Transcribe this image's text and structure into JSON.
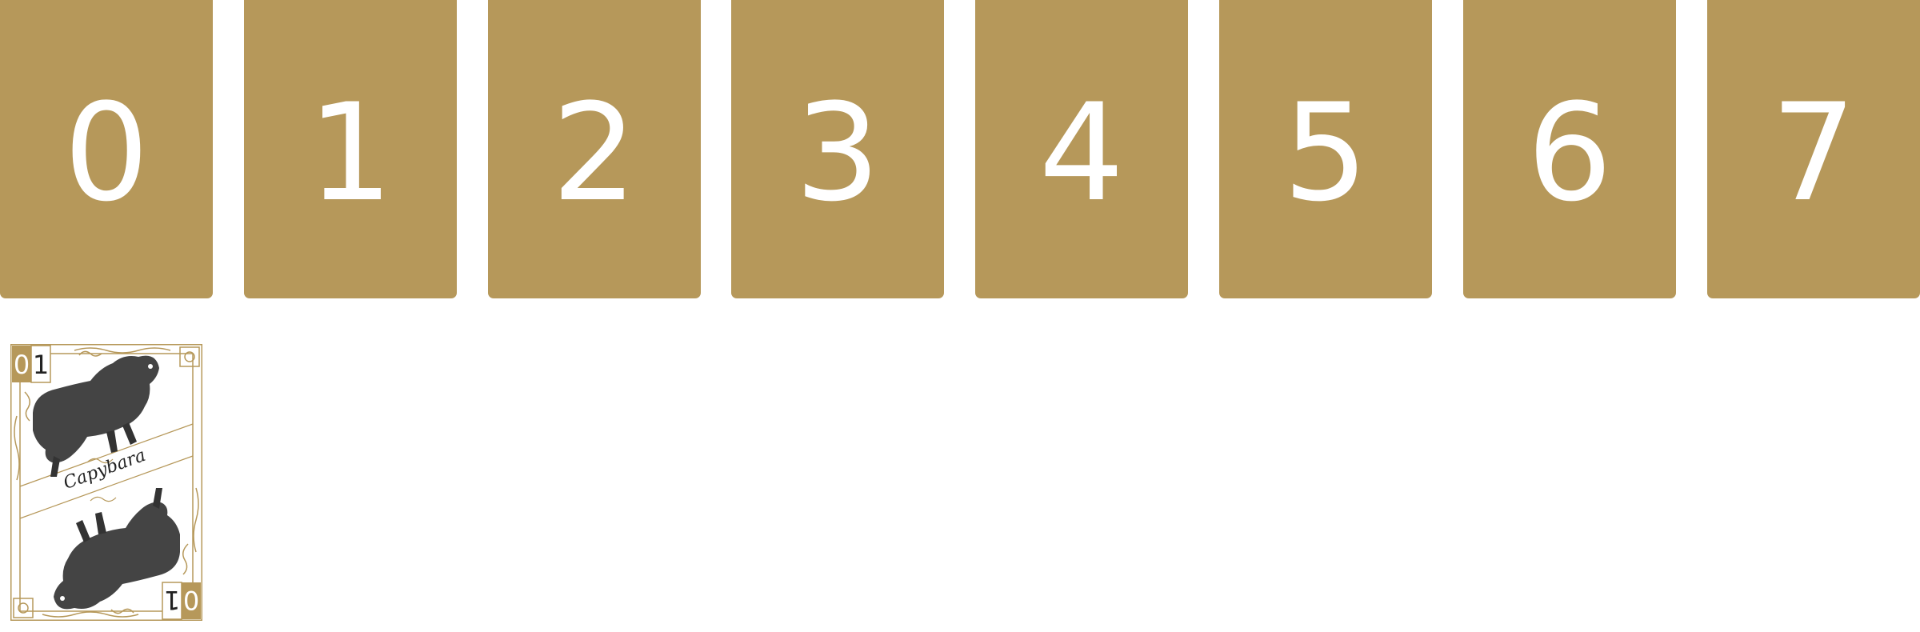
{
  "colors": {
    "slot_fill": "#b6985a",
    "card_accent": "#b6985a",
    "card_background": "#ffffff",
    "slot_text": "#ffffff",
    "ink": "#222222"
  },
  "slots": [
    {
      "label": "0"
    },
    {
      "label": "1"
    },
    {
      "label": "2"
    },
    {
      "label": "3"
    },
    {
      "label": "4"
    },
    {
      "label": "5"
    },
    {
      "label": "6"
    },
    {
      "label": "7"
    }
  ],
  "card": {
    "name": "Capybara",
    "corner_top_left": {
      "gold_digit": "0",
      "white_digit": "1"
    },
    "corner_bottom_right": {
      "gold_digit": "0",
      "white_digit": "1"
    },
    "illustration": "capybara-illustration"
  }
}
